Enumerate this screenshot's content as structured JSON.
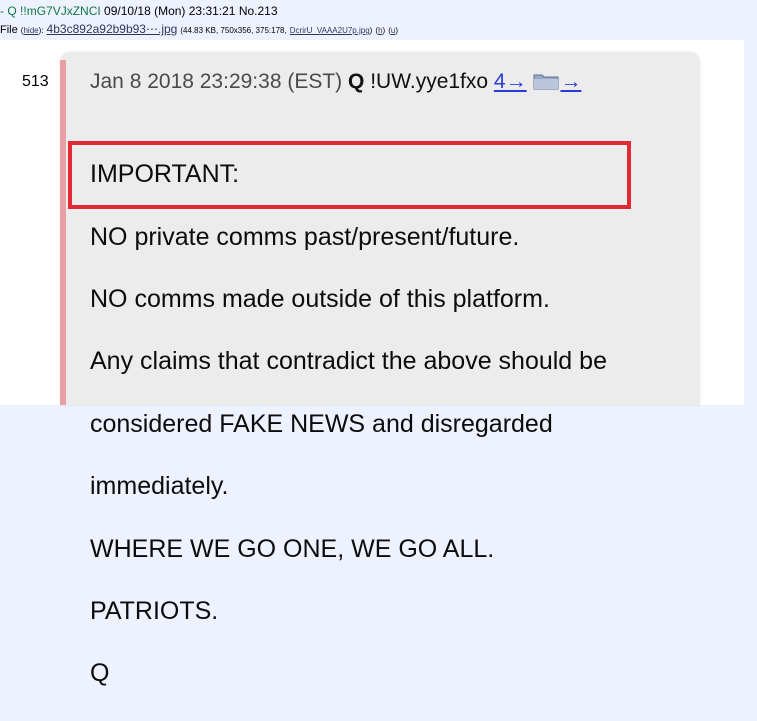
{
  "header": {
    "prefix": "- ",
    "name": "Q",
    "tripcode": "!!mG7VJxZNCI",
    "datetime": "09/10/18 (Mon) 23:31:21",
    "post_number": "No.213"
  },
  "file": {
    "label": "File",
    "hide": "hide",
    "filename": "4b3c892a92b9b93⋯.jpg",
    "meta": "(44.83 KB, 750x356, 375:178,",
    "original_name": "DcrirU_VAAA2U7p.jpg",
    "h": "h",
    "u": "u"
  },
  "post": {
    "number": "513",
    "date": "Jan 8 2018 23:29:38 (EST)",
    "name": "Q",
    "trip": "!UW.yye1fxo",
    "reply_link": "4→",
    "arrow_link": "→",
    "body_lines": [
      "IMPORTANT:",
      "NO private comms past/present/future.",
      "NO comms made outside of this platform.",
      "Any claims that contradict the above should be",
      "considered FAKE NEWS and disregarded",
      "immediately.",
      "WHERE WE GO ONE, WE GO ALL.",
      "PATRIOTS.",
      "Q"
    ]
  },
  "colors": {
    "highlight": "#e02b36",
    "name_green": "#117743",
    "link_blue": "#2a3cd6"
  },
  "icons": {
    "folder": "folder-icon"
  }
}
